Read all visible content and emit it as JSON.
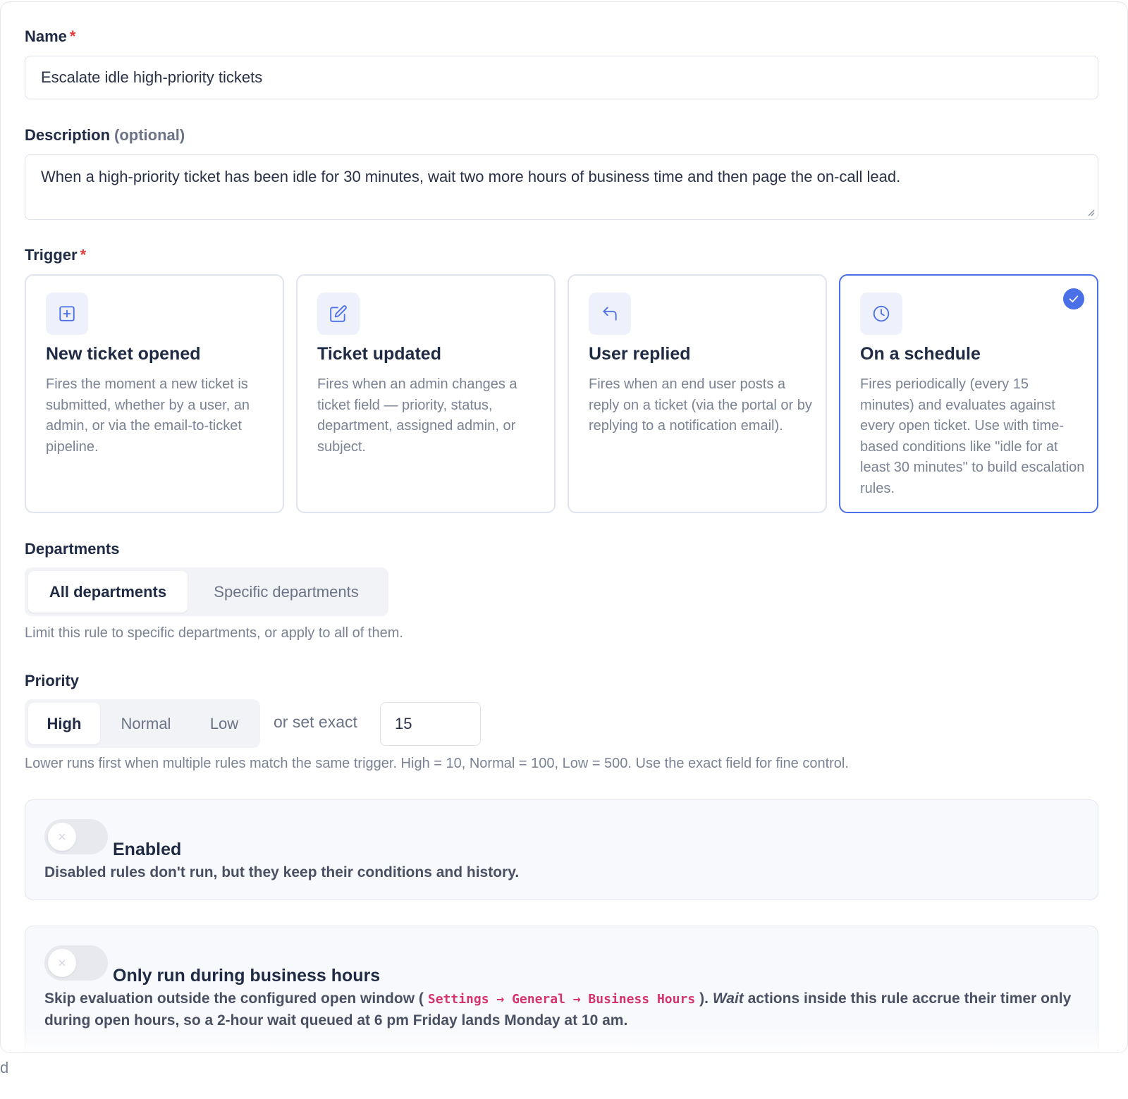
{
  "form": {
    "name": {
      "label": "Name",
      "required_mark": "*",
      "value": "Escalate idle high-priority tickets"
    },
    "description": {
      "label": "Description",
      "optional_hint": "(optional)",
      "value": "When a high-priority ticket has been idle for 30 minutes, wait two more hours of business time and then page the on-call lead."
    },
    "trigger": {
      "label": "Trigger",
      "required_mark": "*",
      "options": [
        {
          "title": "New ticket opened",
          "icon": "plus-square-icon",
          "selected": false,
          "description": "Fires the moment a new ticket is submitted, whether by a user, an admin, or via the email-to-ticket pipeline."
        },
        {
          "title": "Ticket updated",
          "icon": "edit-icon",
          "selected": false,
          "description": "Fires when an admin changes a ticket field — priority, status, department, assigned admin, or subject."
        },
        {
          "title": "User replied",
          "icon": "reply-icon",
          "selected": false,
          "description": "Fires when an end user posts a reply on a ticket (via the portal or by replying to a notification email)."
        },
        {
          "title": "On a schedule",
          "icon": "clock-icon",
          "selected": true,
          "description": "Fires periodically (every 15 minutes) and evaluates against every open ticket. Use with time-based conditions like \"idle for at least 30 minutes\" to build escalation rules."
        }
      ]
    },
    "departments": {
      "label": "Departments",
      "options": [
        "All departments",
        "Specific departments"
      ],
      "selected": "All departments",
      "hint": "Limit this rule to specific departments, or apply to all of them."
    },
    "priority": {
      "label": "Priority",
      "options": [
        "High",
        "Normal",
        "Low"
      ],
      "selected": "High",
      "exact_label": "or set exact",
      "exact_value": "15",
      "hint": "Lower runs first when multiple rules match the same trigger. High = 10, Normal = 100, Low = 500. Use the exact field for fine control."
    },
    "enabled": {
      "title": "Enabled",
      "checked": false,
      "description": "Disabled rules don't run, but they keep their conditions and history."
    },
    "business_hours": {
      "title": "Only run during business hours",
      "checked": false,
      "desc_before": "Skip evaluation outside the configured open window (",
      "settings_path": "Settings → General → Business Hours",
      "desc_middle": ").",
      "desc_italic": "Wait",
      "desc_after": "actions inside this rule accrue their timer only during open hours, so a 2-hour wait queued at 6 pm Friday lands Monday at 10 am."
    }
  },
  "footer_fragment": "d",
  "colors": {
    "accent": "#4b6fe6",
    "required": "#e23b3b",
    "code": "#d6336c",
    "text": "#1f2a44",
    "muted": "#7a8294"
  }
}
